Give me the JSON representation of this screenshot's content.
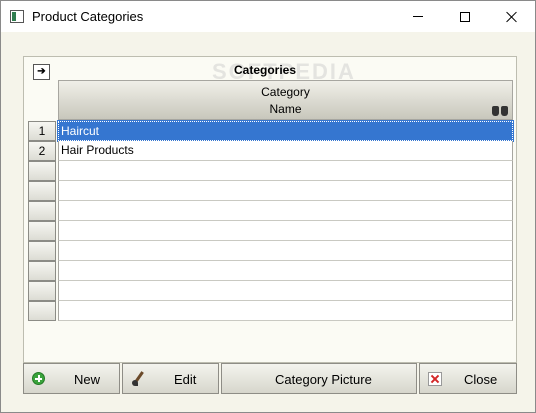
{
  "window": {
    "title": "Product Categories"
  },
  "watermark": "SOFTPEDIA",
  "grid": {
    "title": "Categories",
    "column_header_line1": "Category",
    "column_header_line2": "Name",
    "rows": [
      {
        "num": "1",
        "name": "Haircut",
        "selected": true
      },
      {
        "num": "2",
        "name": "Hair Products",
        "selected": false
      },
      {
        "num": "",
        "name": "",
        "selected": false
      },
      {
        "num": "",
        "name": "",
        "selected": false
      },
      {
        "num": "",
        "name": "",
        "selected": false
      },
      {
        "num": "",
        "name": "",
        "selected": false
      },
      {
        "num": "",
        "name": "",
        "selected": false
      },
      {
        "num": "",
        "name": "",
        "selected": false
      },
      {
        "num": "",
        "name": "",
        "selected": false
      },
      {
        "num": "",
        "name": "",
        "selected": false
      }
    ]
  },
  "toolbar": {
    "new_label": "New",
    "edit_label": "Edit",
    "picture_label": "Category Picture",
    "close_label": "Close"
  },
  "colors": {
    "selection": "#3576d0",
    "background": "#f5f4ea"
  }
}
